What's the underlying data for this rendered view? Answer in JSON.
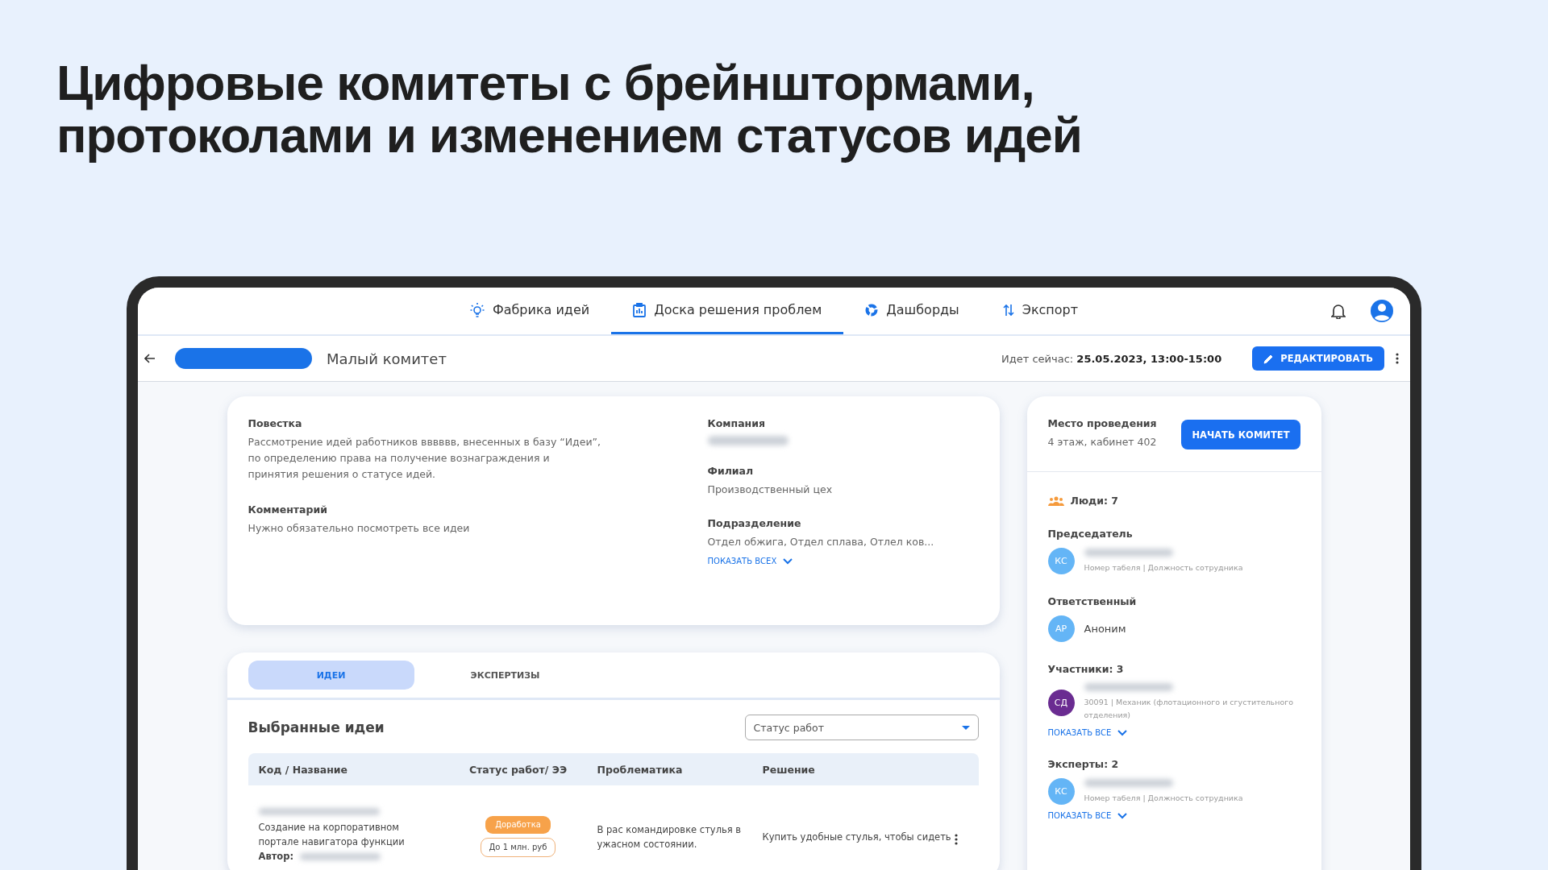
{
  "headline": [
    "Цифровые комитеты с брейнштормами,",
    "протоколами и изменением статусов идей"
  ],
  "nav": [
    {
      "label": "Фабрика идей",
      "kind": "bulb",
      "selected": false
    },
    {
      "label": "Доска решения проблем",
      "kind": "board",
      "selected": true
    },
    {
      "label": "Дашборды",
      "kind": "donut",
      "selected": false
    },
    {
      "label": "Экспорт",
      "kind": "arrows",
      "selected": false
    }
  ],
  "subheader": {
    "title": "Малый комитет",
    "now_label": "Идет сейчас:",
    "now_value": "25.05.2023, 13:00-15:00",
    "edit_button": "РЕДАКТИРОВАТЬ"
  },
  "info": {
    "left": [
      {
        "label": "Повестка",
        "value": "Рассмотрение идей работников вввввв, внесенных в базу “Идеи”, по определению права на получение вознаграждения и принятия решения о статусе идей."
      },
      {
        "label": "Комментарий",
        "value": "Нужно обязательно посмотреть все идеи"
      }
    ],
    "right": [
      {
        "label": "Компания",
        "blurred": true
      },
      {
        "label": "Филиал",
        "value": "Производственный цех"
      },
      {
        "label": "Подразделение",
        "value": "Отдел обжига, Отдел сплава, Отлел ков..."
      }
    ],
    "show_all": "ПОКАЗАТЬ ВСЕХ"
  },
  "tabs": [
    {
      "label": "ИДЕИ",
      "selected": true
    },
    {
      "label": "ЭКСПЕРТИЗЫ",
      "selected": false
    }
  ],
  "ideas": {
    "title": "Выбранные идеи",
    "filter_placeholder": "Статус работ",
    "columns": [
      "Код / Название",
      "Статус работ/ ЭЭ",
      "Проблематика",
      "Решение"
    ],
    "rows": [
      {
        "name": "Создание на корпоративном портале навигатора функции",
        "author_label": "Автор:",
        "status": "Доработка",
        "effect": "До 1 млн. руб",
        "problem": "В рас командировке стулья в ужасном состоянии.",
        "solution": "Купить удобные стулья, чтобы сидеть"
      }
    ]
  },
  "venue": {
    "label": "Место проведения",
    "value": "4 этаж, кабинет 402",
    "start_button": "НАЧАТЬ КОМИТЕТ"
  },
  "people": {
    "count_label": "Люди: 7",
    "groups": [
      {
        "title": "Председатель",
        "members": [
          {
            "initials": "КС",
            "color": "#64b5f6",
            "blurred_name": true,
            "details": "Номер табеля | Должность сотрудника"
          }
        ]
      },
      {
        "title": "Ответственный",
        "members": [
          {
            "initials": "АР",
            "color": "#64b5f6",
            "name": "Аноним"
          }
        ]
      },
      {
        "title": "Участники: 3",
        "members": [
          {
            "initials": "СД",
            "color": "#6a2c91",
            "blurred_name": true,
            "details": "30091 | Механик (флотационного и сгустительного отделения)"
          }
        ],
        "show_all": "ПОКАЗАТЬ ВСЕ"
      },
      {
        "title": "Эксперты: 2",
        "members": [
          {
            "initials": "КС",
            "color": "#64b5f6",
            "blurred_name": true,
            "details": "Номер табеля | Должность сотрудника"
          }
        ],
        "show_all": "ПОКАЗАТЬ ВСЕ"
      }
    ]
  }
}
